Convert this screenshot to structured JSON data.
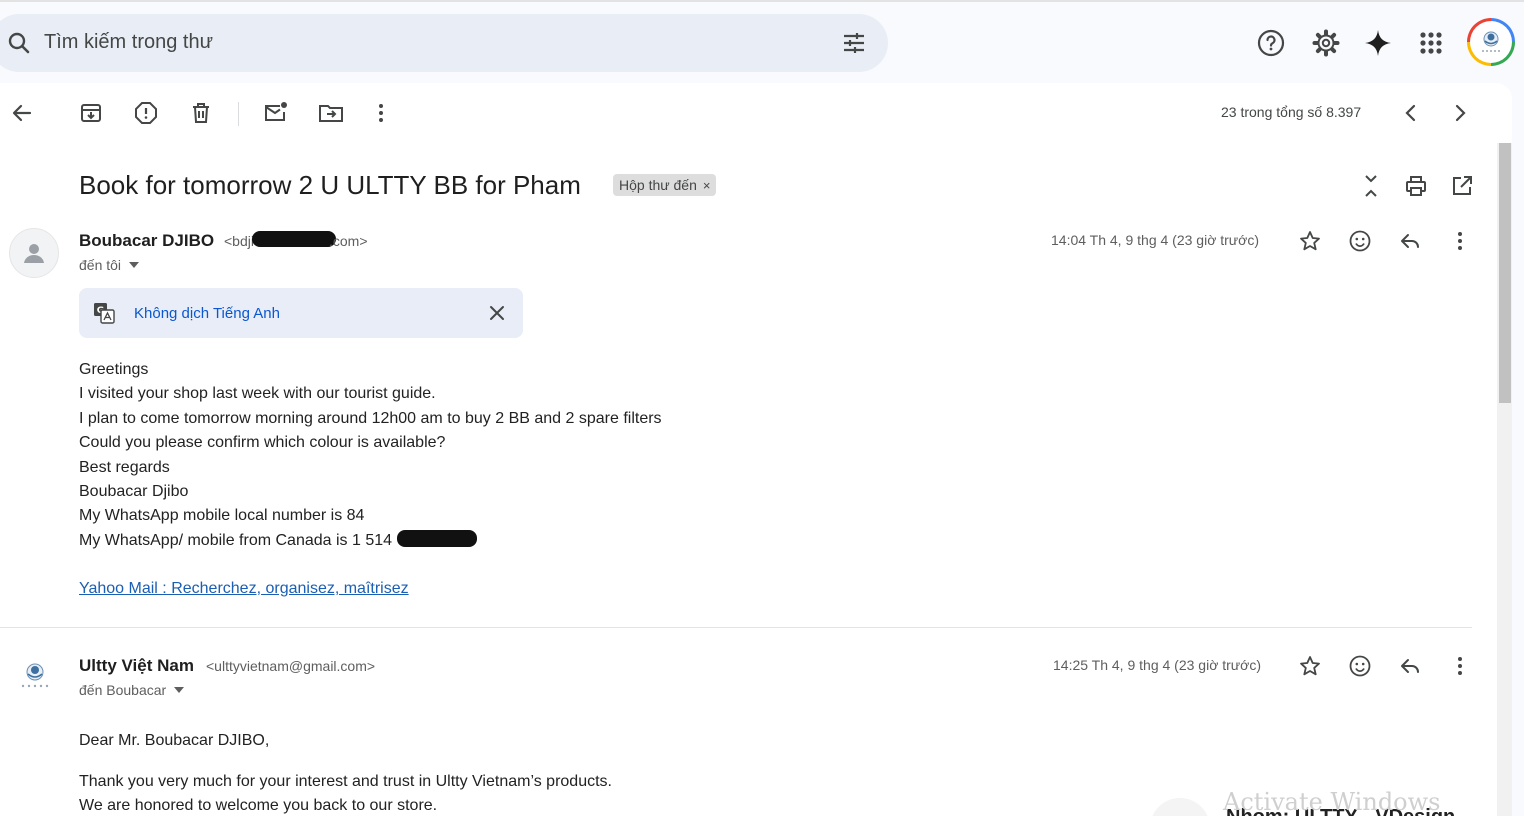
{
  "search": {
    "placeholder": "Tìm kiếm trong thư"
  },
  "header_icons": [
    "help-icon",
    "settings-icon",
    "gemini-icon",
    "apps-icon"
  ],
  "toolbar": {
    "pager_text": "23 trong tổng số 8.397",
    "icons": [
      "back-arrow-icon",
      "archive-icon",
      "report-spam-icon",
      "delete-icon",
      "mark-unread-icon",
      "move-to-icon",
      "more-vert-icon",
      "chevron-left-icon",
      "chevron-right-icon"
    ]
  },
  "thread": {
    "subject": "Book for tomorrow 2 U ULTTY BB for Pham",
    "label": "Hộp thư đến",
    "label_close": "×"
  },
  "messages": [
    {
      "sender_name": "Boubacar DJIBO",
      "sender_email_start": "<bdji",
      "sender_email_end": ".com>",
      "to": "đến tôi",
      "date": "14:04 Th 4, 9 thg 4 (23 giờ trước)",
      "translate": "Không dịch Tiếng Anh",
      "body": [
        "Greetings",
        "I visited your shop last week with our tourist guide.",
        "I plan to come tomorrow  morning around 12h00 am to buy 2 BB and 2 spare filters",
        "Could you please confirm which colour is available?",
        "Best regards",
        "Boubacar Djibo",
        "My WhatsApp mobile local number is 84",
        "My WhatsApp/ mobile from Canada is 1 514"
      ],
      "link": "Yahoo Mail : Recherchez, organisez, maîtrisez"
    },
    {
      "sender_name": "Ultty Việt Nam",
      "sender_email": "<ulttyvietnam@gmail.com>",
      "to": "đến Boubacar",
      "date": "14:25 Th 4, 9 thg 4 (23 giờ trước)",
      "body": [
        "Dear Mr. Boubacar DJIBO,",
        "Thank you very much for your interest and trust in Ultty Vietnam’s products.",
        "We are honored to welcome you back to our store."
      ]
    }
  ],
  "overlay": {
    "watermark": "Activate Windows",
    "partial_card": "Nhom: ULTTY - VDesign"
  }
}
